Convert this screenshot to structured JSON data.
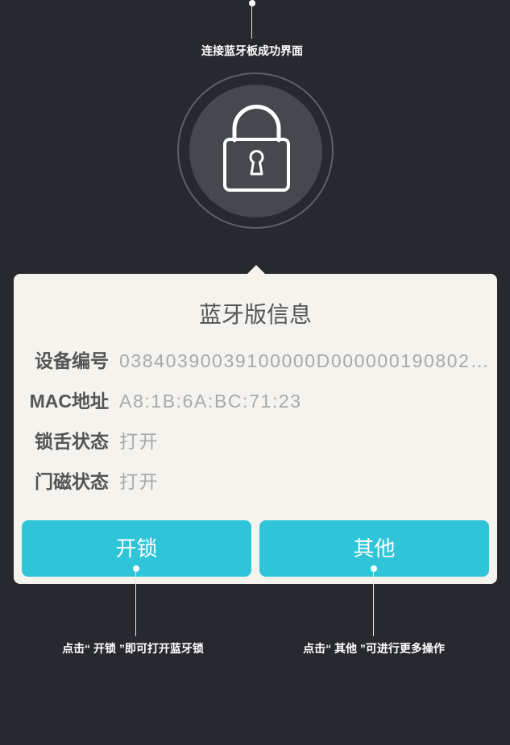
{
  "annotations": {
    "top": "连接蓝牙板成功界面",
    "unlock": "点击“ 开锁 ”即可打开蓝牙锁",
    "other": "点击“ 其他 ”可进行更多操作"
  },
  "status_icon": "lock-icon",
  "card": {
    "title": "蓝牙版信息",
    "rows": [
      {
        "label": "设备编号",
        "value": "03840390039100000D000000190802…"
      },
      {
        "label": "MAC地址",
        "value": "A8:1B:6A:BC:71:23"
      },
      {
        "label": "锁舌状态",
        "value": "打开"
      },
      {
        "label": "门磁状态",
        "value": "打开"
      }
    ],
    "buttons": {
      "unlock": "开锁",
      "other": "其他"
    }
  },
  "colors": {
    "background": "#27292e",
    "card": "#f4f3ee",
    "accent": "#30c4d9",
    "label": "#555555",
    "value": "#a9a9a9"
  }
}
